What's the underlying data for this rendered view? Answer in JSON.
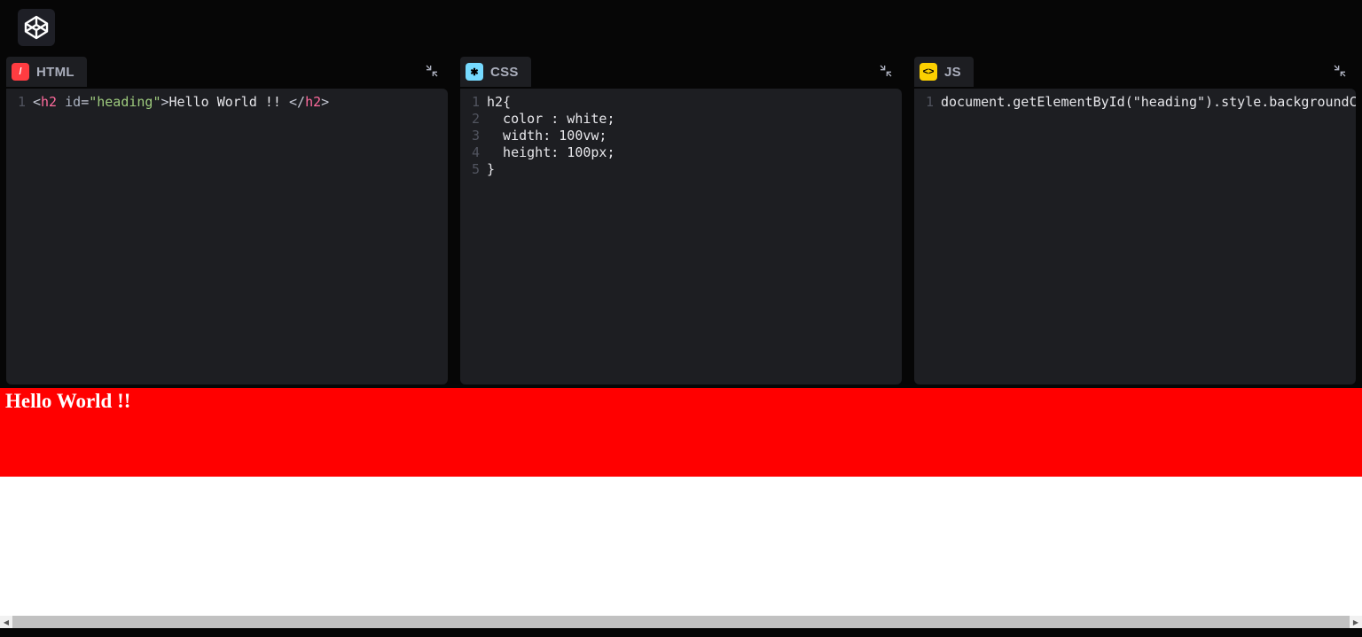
{
  "app": {
    "logo_name": "codepen-logo"
  },
  "panels": {
    "html": {
      "label": "HTML",
      "icon_glyph": "/",
      "lines": [
        {
          "num": "1",
          "segments": [
            {
              "cls": "tok-punc",
              "t": "<"
            },
            {
              "cls": "tok-tag",
              "t": "h2"
            },
            {
              "cls": "tok-attr",
              "t": " id"
            },
            {
              "cls": "tok-punc",
              "t": "="
            },
            {
              "cls": "tok-str",
              "t": "\"heading\""
            },
            {
              "cls": "tok-punc",
              "t": ">"
            },
            {
              "cls": "tok-text",
              "t": "Hello World !! "
            },
            {
              "cls": "tok-punc",
              "t": "</"
            },
            {
              "cls": "tok-tag",
              "t": "h2"
            },
            {
              "cls": "tok-punc",
              "t": ">"
            }
          ]
        }
      ]
    },
    "css": {
      "label": "CSS",
      "icon_glyph": "✱",
      "lines": [
        {
          "num": "1",
          "segments": [
            {
              "cls": "tok-text",
              "t": "h2{"
            }
          ]
        },
        {
          "num": "2",
          "segments": [
            {
              "cls": "tok-text",
              "t": "  color : white;"
            }
          ]
        },
        {
          "num": "3",
          "segments": [
            {
              "cls": "tok-text",
              "t": "  width: 100vw;"
            }
          ]
        },
        {
          "num": "4",
          "segments": [
            {
              "cls": "tok-text",
              "t": "  height: 100px;"
            }
          ]
        },
        {
          "num": "5",
          "segments": [
            {
              "cls": "tok-text",
              "t": "}"
            }
          ]
        }
      ]
    },
    "js": {
      "label": "JS",
      "icon_glyph": "<>",
      "lines": [
        {
          "num": "1",
          "segments": [
            {
              "cls": "tok-text",
              "t": "document.getElementById(\"heading\").style.backgroundColor = \"red\";"
            }
          ]
        }
      ]
    }
  },
  "output": {
    "heading_text": "Hello World !!"
  }
}
